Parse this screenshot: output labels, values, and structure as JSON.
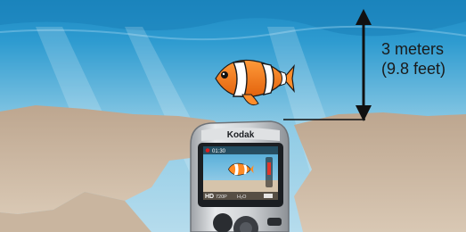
{
  "depth_label": {
    "meters": "3 meters",
    "feet": "(9.8 feet)"
  },
  "camera": {
    "brand": "Kodak",
    "timer": "01:30",
    "hd_label": "HD",
    "resolution": "720P",
    "mode": "H₂O"
  },
  "colors": {
    "water_top": "#1f8fc7",
    "water_mid": "#7fc3e3",
    "sand": "#c2ab92",
    "arrow": "#111111",
    "fish_orange": "#f07a1c",
    "camera_body": "#c9ccd0"
  }
}
